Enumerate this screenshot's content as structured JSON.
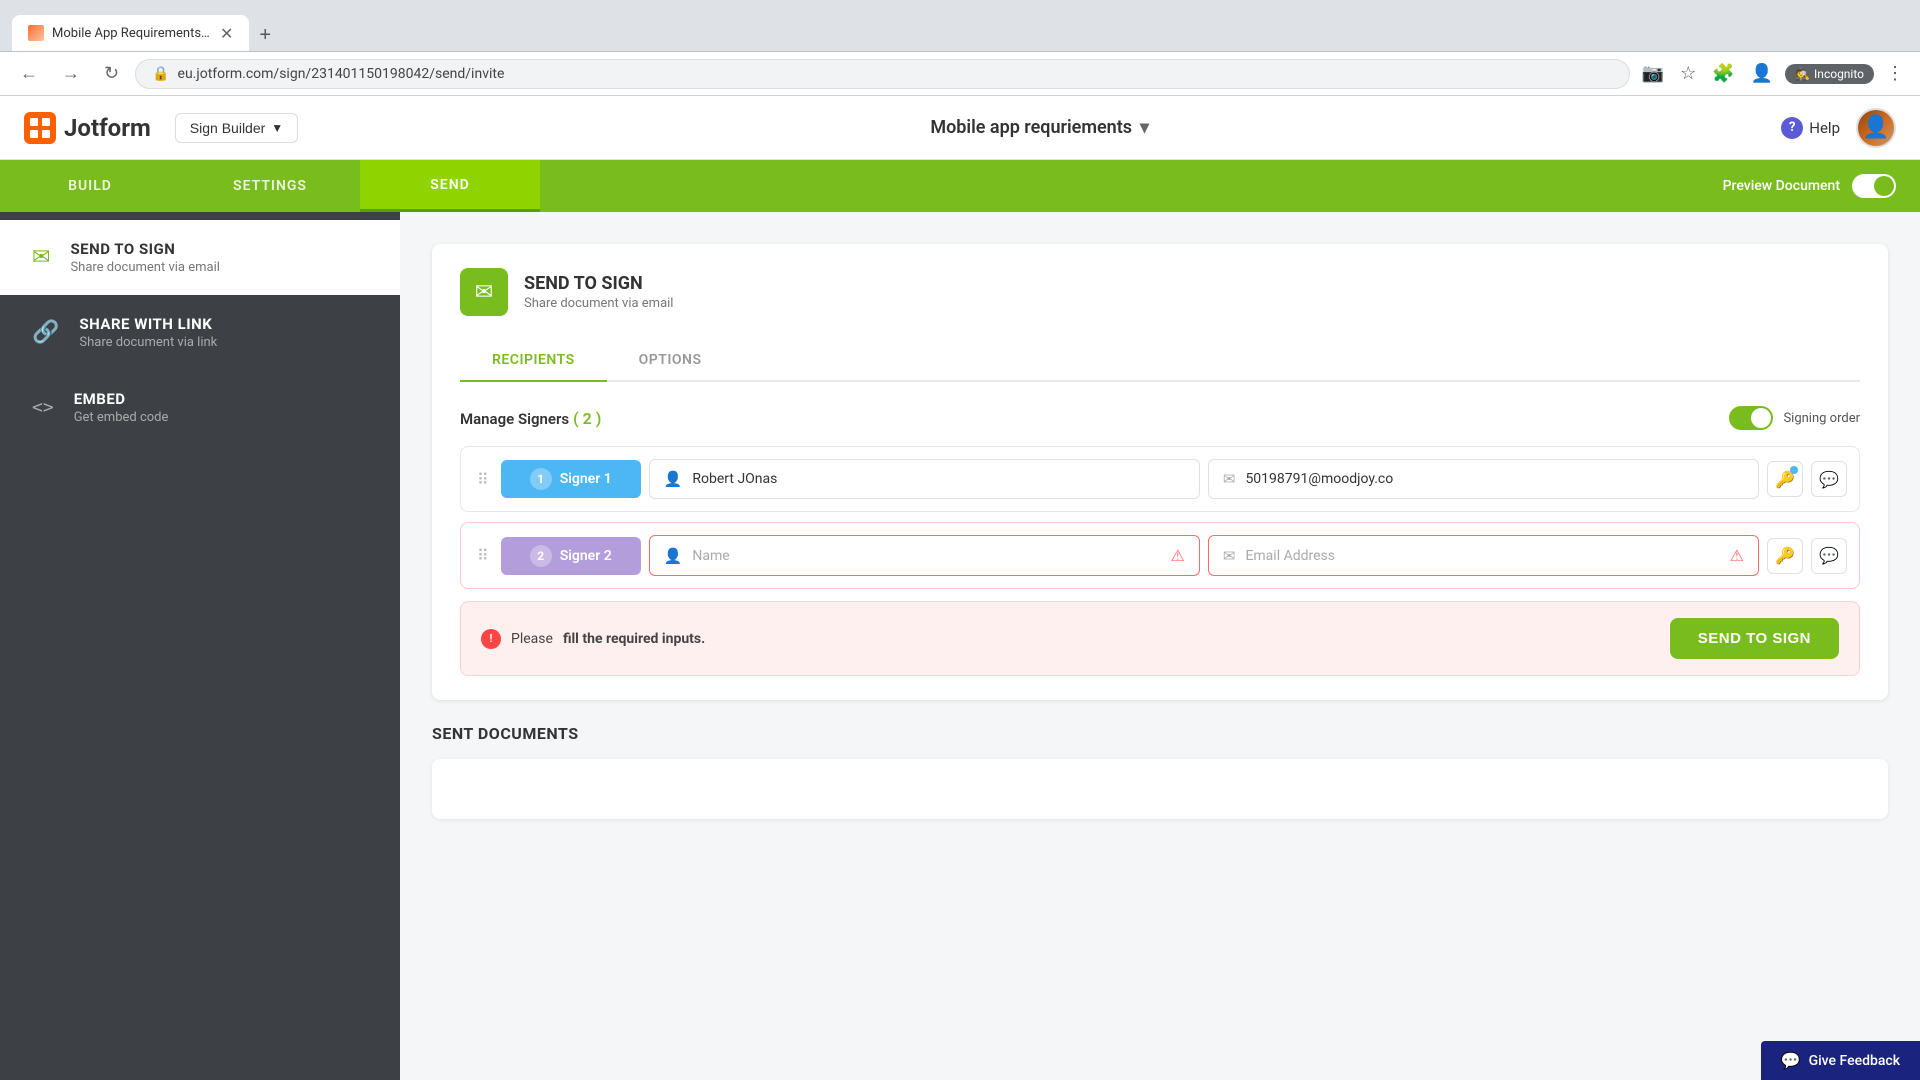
{
  "browser": {
    "tab_title": "Mobile App Requirements - Cop...",
    "tab_favicon": "🔴",
    "url": "eu.jotform.com/sign/231401150198042/send/invite",
    "back_btn": "←",
    "forward_btn": "→",
    "reload_btn": "↻",
    "incognito_label": "Incognito",
    "new_tab_btn": "+"
  },
  "header": {
    "logo_text": "Jotform",
    "sign_builder_label": "Sign Builder",
    "title": "Mobile app requriements",
    "help_label": "Help",
    "help_icon_char": "?"
  },
  "nav": {
    "tabs": [
      {
        "id": "build",
        "label": "BUILD",
        "active": false
      },
      {
        "id": "settings",
        "label": "SETTINGS",
        "active": false
      },
      {
        "id": "send",
        "label": "SEND",
        "active": true
      }
    ],
    "preview_label": "Preview Document"
  },
  "sidebar": {
    "items": [
      {
        "id": "send-to-sign",
        "icon": "✉",
        "title": "SEND TO SIGN",
        "desc": "Share document via email",
        "active": true
      },
      {
        "id": "share-with-link",
        "icon": "🔗",
        "title": "SHARE WITH LINK",
        "desc": "Share document via link",
        "active": false
      },
      {
        "id": "embed",
        "icon": "<>",
        "title": "EMBED",
        "desc": "Get embed code",
        "active": false
      }
    ]
  },
  "send_card": {
    "icon": "✉",
    "title": "SEND TO SIGN",
    "desc": "Share document via email",
    "tabs": [
      {
        "id": "recipients",
        "label": "RECIPIENTS",
        "active": true
      },
      {
        "id": "options",
        "label": "OPTIONS",
        "active": false
      }
    ],
    "manage_signers_label": "Manage Signers",
    "signers_count": "( 2 )",
    "signing_order_label": "Signing order",
    "signers": [
      {
        "num": "1",
        "label": "Signer 1",
        "badge_class": "signer-badge-1",
        "name_value": "Robert JOnas",
        "email_value": "50198791@moodjoy.co",
        "has_error": false,
        "name_placeholder": "Name",
        "email_placeholder": "Email Address"
      },
      {
        "num": "2",
        "label": "Signer 2",
        "badge_class": "signer-badge-2",
        "name_value": "",
        "email_value": "",
        "has_error": true,
        "name_placeholder": "Name",
        "email_placeholder": "Email Address"
      }
    ],
    "error_msg_prefix": "Please ",
    "error_msg_bold": "fill the required inputs.",
    "send_btn_label": "SEND TO SIGN"
  },
  "sent_docs": {
    "title": "SENT DOCUMENTS"
  },
  "feedback": {
    "label": "Give Feedback",
    "icon": "💬"
  }
}
